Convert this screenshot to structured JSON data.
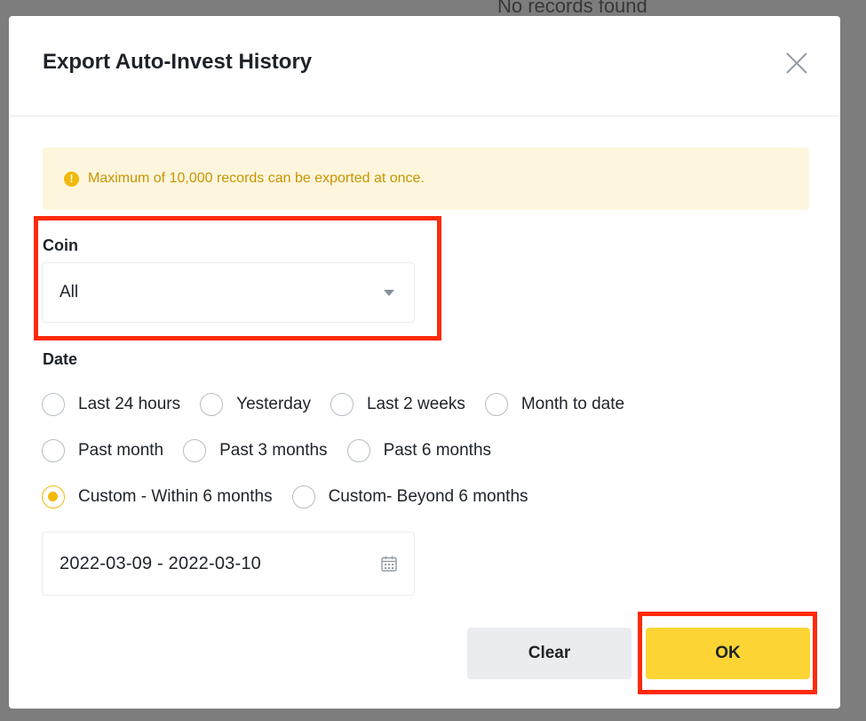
{
  "background": {
    "partial_text": "No records found"
  },
  "dialog": {
    "title": "Export Auto-Invest History",
    "notice": "Maximum of 10,000 records can be exported at once.",
    "notice_icon": "!",
    "coin": {
      "label": "Coin",
      "selected": "All"
    },
    "date": {
      "label": "Date",
      "options": [
        {
          "label": "Last 24 hours",
          "checked": false
        },
        {
          "label": "Yesterday",
          "checked": false
        },
        {
          "label": "Last 2 weeks",
          "checked": false
        },
        {
          "label": "Month to date",
          "checked": false
        },
        {
          "label": "Past month",
          "checked": false
        },
        {
          "label": "Past 3 months",
          "checked": false
        },
        {
          "label": "Past 6 months",
          "checked": false
        },
        {
          "label": "Custom - Within 6 months",
          "checked": true
        },
        {
          "label": "Custom- Beyond 6 months",
          "checked": false
        }
      ],
      "range_value": "2022-03-09 - 2022-03-10"
    },
    "buttons": {
      "clear": "Clear",
      "ok": "OK"
    }
  },
  "colors": {
    "accent": "#f0b90b",
    "primary_button": "#fcd535",
    "highlight_box": "#ff2a0c",
    "notice_bg": "#fdf6dd"
  },
  "icons": {
    "close": "close-icon",
    "caret": "caret-down-icon",
    "calendar": "calendar-icon",
    "notice": "exclamation-icon"
  }
}
